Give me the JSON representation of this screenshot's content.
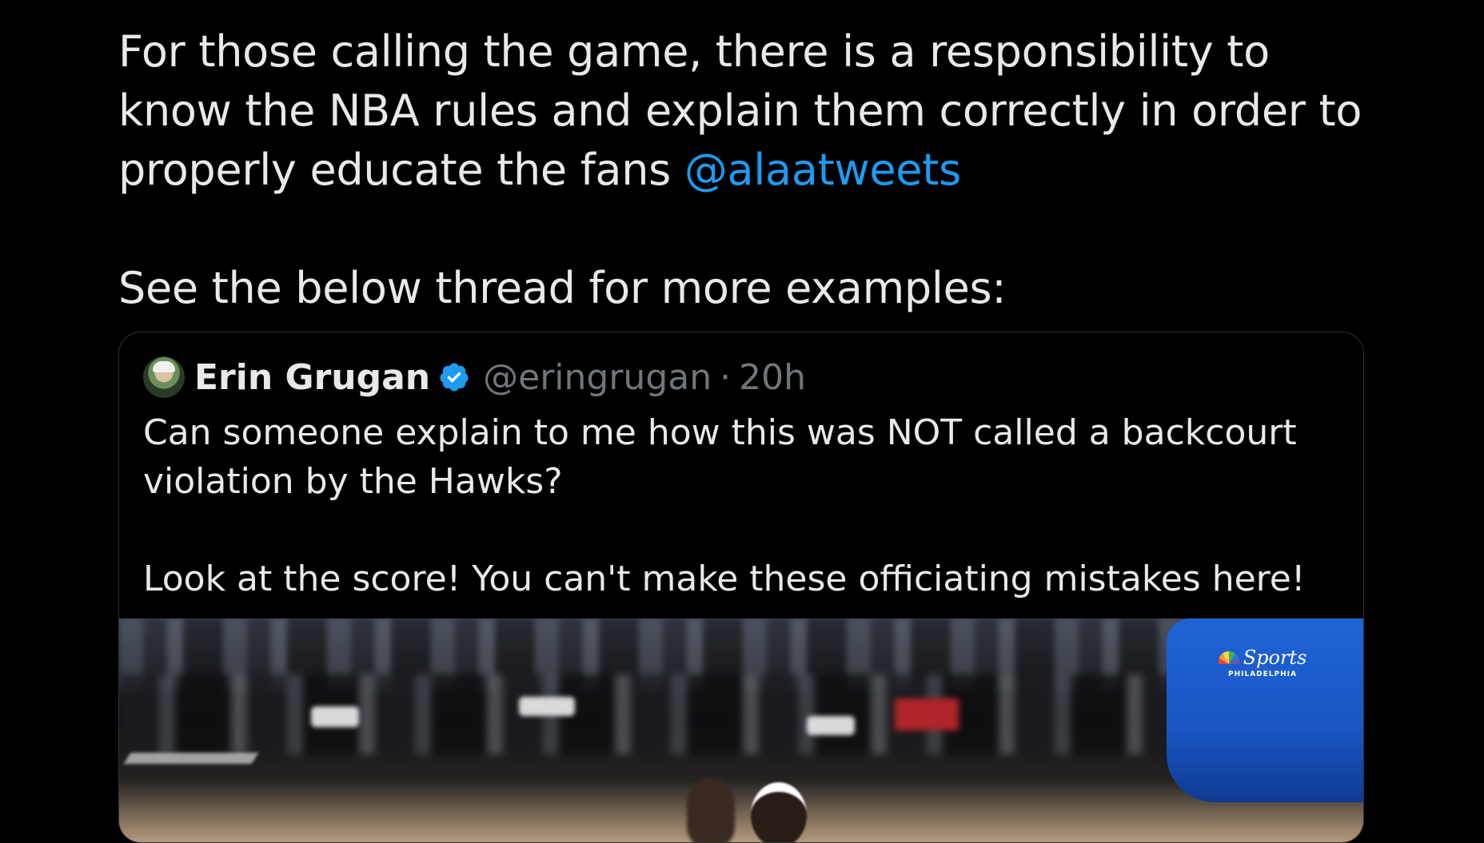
{
  "tweet": {
    "text_line_1": "For those calling the game, there is a responsibility to",
    "text_line_2": "know the NBA rules and explain them correctly in order to",
    "text_line_3_pre": "properly educate the fans ",
    "mention": "@alaatweets",
    "text_line_4": "See the below thread for more examples:"
  },
  "quote": {
    "author_name": "Erin Grugan",
    "handle": "@eringrugan",
    "separator": "·",
    "time": "20h",
    "text_line_1": "Can someone explain to me how this was NOT called a backcourt",
    "text_line_2": "violation by the Hawks?",
    "text_line_3": "Look at the score! You can't make these officiating mistakes here!",
    "media": {
      "network_brand": "Sports",
      "network_city": "PHILADELPHIA"
    }
  },
  "colors": {
    "background": "#000000",
    "text": "#e7e9ea",
    "secondary_text": "#71767b",
    "accent": "#1d9bf0",
    "border": "#2f3336"
  },
  "icons": {
    "verified": "verified-badge-icon",
    "avatar": "avatar"
  }
}
